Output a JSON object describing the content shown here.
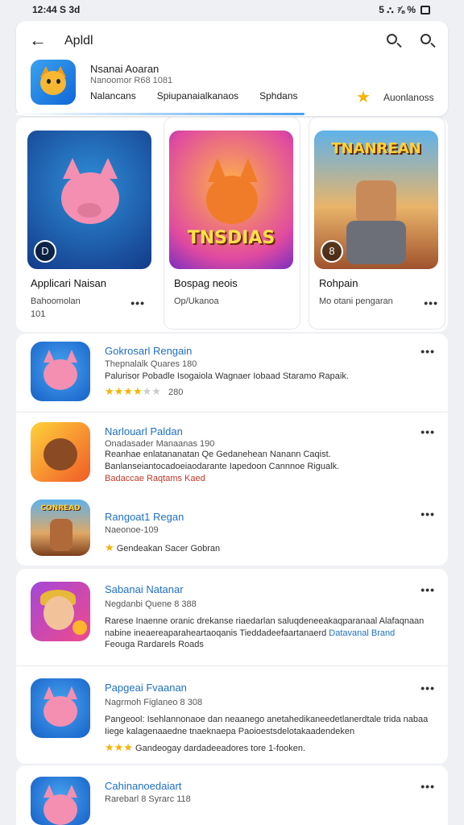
{
  "status_bar": {
    "time": "12:44 S 3d",
    "indicators": "5 ⛬ ⅞ %"
  },
  "header": {
    "back_icon": "back-arrow-icon",
    "title": "Apldl",
    "developer": {
      "name": "Nsanai Aoaran",
      "subtitle": "Nanoomor R68 1081"
    },
    "tabs": [
      "Nalancans",
      "Spiupanaialkanaos",
      "Sphdans"
    ],
    "award": {
      "icon": "star-badge-icon",
      "label": "Auonlanoss"
    }
  },
  "featured": [
    {
      "name": "Applicari Naisan",
      "subtitle": "Bahoomolan",
      "count": "101",
      "badge": "D",
      "art_text": ""
    },
    {
      "name": "Bospag neois",
      "subtitle": "Op/Ukanoa",
      "count": "",
      "badge": "",
      "art_text": "TNSDIAS"
    },
    {
      "name": "Rohpain",
      "subtitle": "Mo otani pengaran",
      "count": "",
      "badge": "8",
      "art_text": "TNANREAN"
    }
  ],
  "list_group_1": [
    {
      "title": "Gokrosarl Rengain",
      "meta": "Thepnalalk Quares 180",
      "desc": "Palurisor Pobadle Isogaiola Wagnaer Iobaad Staramo Rapaik.",
      "rating_value": 3.5,
      "rating_count": "280"
    },
    {
      "title": "Narlouarl Paldan",
      "meta": "Onadasader Manaanas 190",
      "desc": "Reanhae enlatananatan Qe Gedanehean Nanann Caqist. Banlanseiantocadoeiaodarante Iapedoon Cannnoe Rigualk.",
      "extra": "Badaccae Raqtams Kaed"
    },
    {
      "title": "Rangoat1 Regan",
      "meta": "Naeonoe-109",
      "extra": "Gendeakan Sacer Gobran"
    }
  ],
  "list_group_2": [
    {
      "title": "Sabanai Natanar",
      "meta": "Negdanbi Quene 8 388",
      "desc": "Rarese Inaenne oranic drekanse riaedarlan saluqdeneeakaqparanaal Alafaqnaan nabine ineaereaparaheartaoqanis Tieddadeefaartanaerd",
      "desc_link": "Datavanal Brand",
      "extra": "Feouga Rardarels Roads"
    },
    {
      "title": "Papgeai Fvaanan",
      "meta": "Nagrmoh Figlaneo 8 308",
      "desc": "Pangeool: Isehlannonaoe dan neaanego anetahedikaneedetlanerdtale trida nabaa Iiege kalagenaaedne tnaeknaepa Paoioestsdelotakaadendeken",
      "extra": "Gandeogay dardadeeadores tore 1-fooken."
    },
    {
      "title": "Cahinanoedaiart",
      "meta": "Rarebarl 8 Syrarc 118"
    }
  ],
  "colors": {
    "link_blue": "#1f6fc4",
    "star_gold": "#f5b301",
    "accent_red": "#c0392b"
  }
}
